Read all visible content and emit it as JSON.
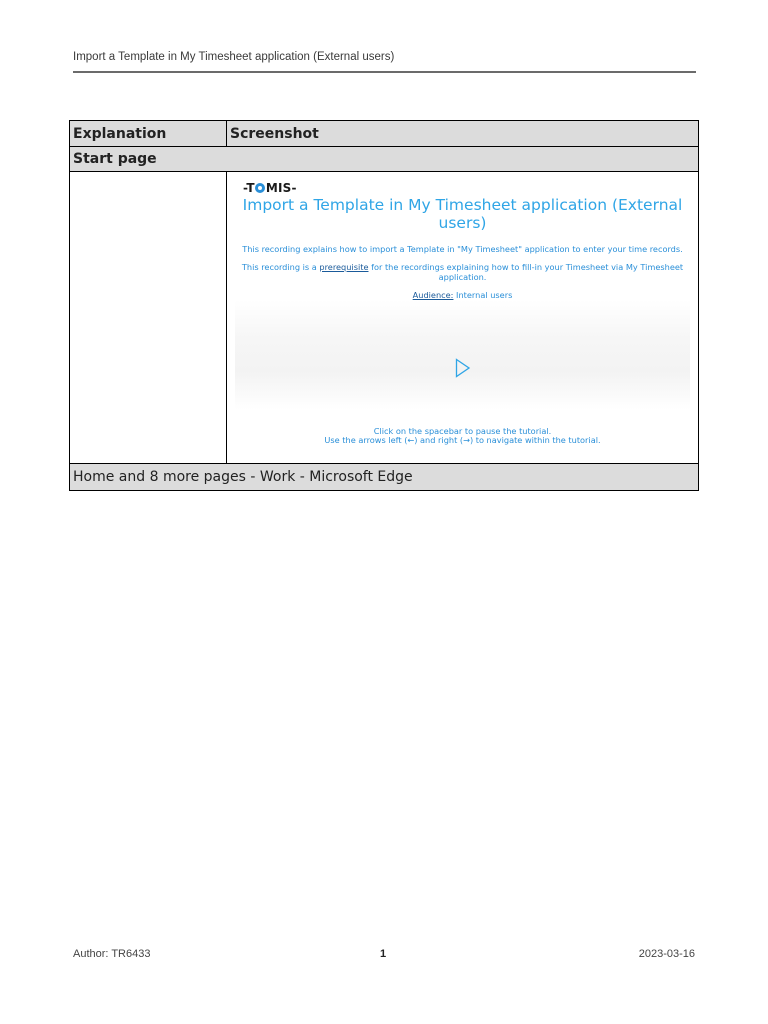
{
  "header": {
    "title": "Import a Template in My Timesheet application (External users)"
  },
  "table": {
    "col_explanation": "Explanation",
    "col_screenshot": "Screenshot",
    "section_title": "Start page",
    "caption": "Home and 8 more pages - Work - Microsoft Edge"
  },
  "screenshot": {
    "logo_left": "-T",
    "logo_right": "MIS-",
    "title": "Import a Template in My Timesheet application (External users)",
    "line1": "This recording explains how to import a Template in \"My Timesheet\" application to enter your time records.",
    "line2_pre": "This recording is a ",
    "line2_link": "prerequisite",
    "line2_post": " for the recordings explaining how to fill-in your Timesheet via My Timesheet application.",
    "audience_label": "Audience:",
    "audience_value": " Internal users",
    "hint1": "Click on the spacebar to pause the tutorial.",
    "hint2": "Use the arrows left (←) and right (→) to navigate within the tutorial."
  },
  "footer": {
    "author": "Author: TR6433",
    "page_number": "1",
    "date": "2023-03-16"
  },
  "colors": {
    "accent_blue": "#2fa5e6",
    "text_blue": "#2a8fd8",
    "header_gray": "#dcdcdc"
  },
  "icons": [
    "play-icon",
    "tomis-logo"
  ]
}
